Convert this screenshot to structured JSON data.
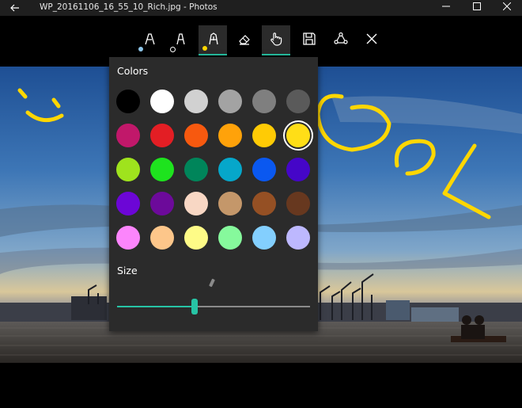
{
  "window": {
    "title": "WP_20161106_16_55_10_Rich.jpg - Photos",
    "back_icon": "arrow-left-icon",
    "minimize_icon": "minimize-icon",
    "maximize_icon": "maximize-icon",
    "close_icon": "close-icon"
  },
  "toolbar": {
    "accent_color": "#27c4a5",
    "tools": [
      {
        "name": "ballpoint-pen",
        "icon": "ballpoint-pen-icon",
        "indicator_color": "#8fc7ea",
        "active": false
      },
      {
        "name": "pencil",
        "icon": "pencil-icon",
        "indicator_color": "outline",
        "active": false
      },
      {
        "name": "calligraphy-pen",
        "icon": "calligraphy-pen-icon",
        "indicator_color": "#ffd700",
        "active": true
      },
      {
        "name": "eraser",
        "icon": "eraser-icon",
        "active": false
      },
      {
        "name": "touch-writing",
        "icon": "touch-writing-icon",
        "active": true
      },
      {
        "name": "save",
        "icon": "save-icon",
        "active": false
      },
      {
        "name": "share",
        "icon": "share-icon",
        "active": false
      },
      {
        "name": "close-ink",
        "icon": "close-icon",
        "active": false
      }
    ]
  },
  "pen_panel": {
    "colors_label": "Colors",
    "size_label": "Size",
    "size_level": 0.4,
    "selected_color": "#ffde17",
    "swatches": [
      [
        "#000000",
        "#ffffff",
        "#d1d1d1",
        "#a3a3a3",
        "#7f7f7f",
        "#5a5a5a"
      ],
      [
        "#c1186a",
        "#e31e24",
        "#f7590f",
        "#ffa20a",
        "#ffcb05",
        "#ffde17"
      ],
      [
        "#9fe31d",
        "#1ee31e",
        "#00855a",
        "#06a7ca",
        "#0a58f0",
        "#4506c8"
      ],
      [
        "#6c06d6",
        "#6c0a9a",
        "#f8d7c4",
        "#c4976a",
        "#955024",
        "#67381f"
      ],
      [
        "#fc85fc",
        "#fdc68a",
        "#fefb87",
        "#86f99c",
        "#83cffe",
        "#bdb8fe"
      ]
    ]
  }
}
